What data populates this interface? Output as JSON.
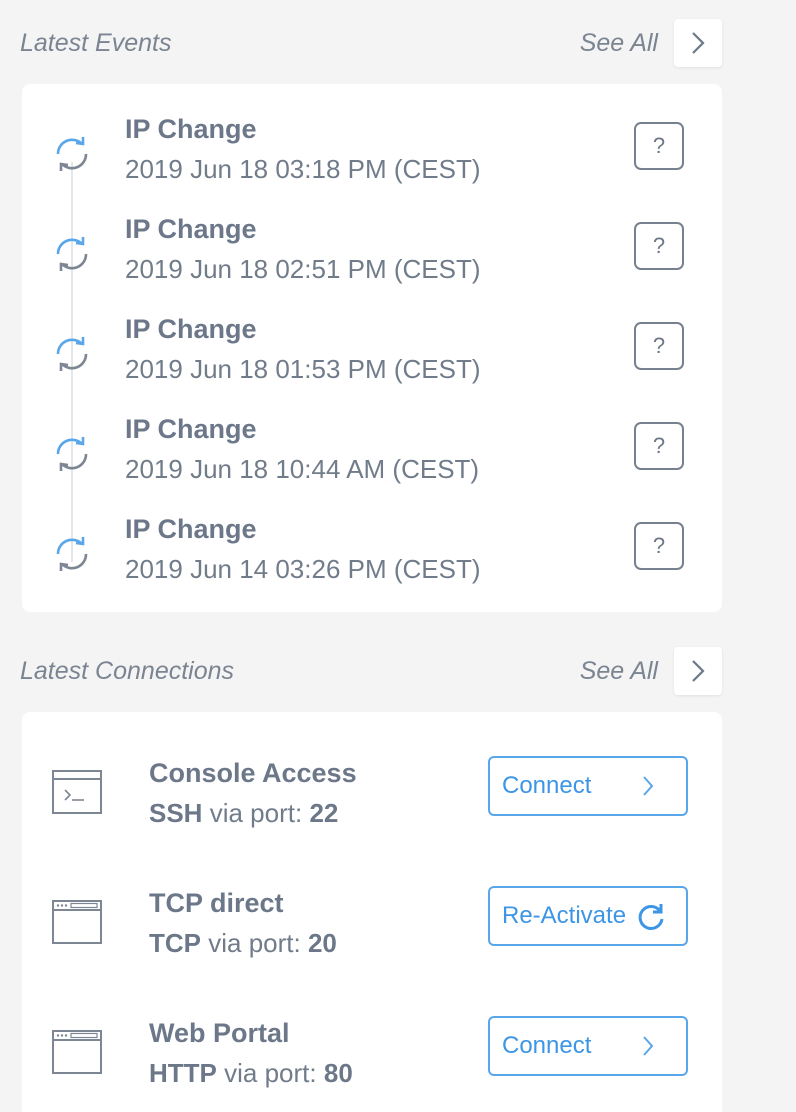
{
  "events_section": {
    "title": "Latest Events",
    "see_all": "See All",
    "items": [
      {
        "title": "IP Change",
        "date": "2019 Jun 18 03:18 PM (CEST)",
        "help": "?"
      },
      {
        "title": "IP Change",
        "date": "2019 Jun 18 02:51 PM (CEST)",
        "help": "?"
      },
      {
        "title": "IP Change",
        "date": "2019 Jun 18 01:53 PM (CEST)",
        "help": "?"
      },
      {
        "title": "IP Change",
        "date": "2019 Jun 18 10:44 AM (CEST)",
        "help": "?"
      },
      {
        "title": "IP Change",
        "date": "2019 Jun 14 03:26 PM (CEST)",
        "help": "?"
      }
    ]
  },
  "connections_section": {
    "title": "Latest Connections",
    "see_all": "See All",
    "items": [
      {
        "title": "Console Access",
        "protocol": "SSH",
        "via": "via port:",
        "port": "22",
        "icon": "terminal-window-icon",
        "action": "Connect",
        "action_icon": "chevron-right-icon"
      },
      {
        "title": "TCP direct",
        "protocol": "TCP",
        "via": "via port:",
        "port": "20",
        "icon": "browser-window-icon",
        "action": "Re-Activate",
        "action_icon": "refresh-icon"
      },
      {
        "title": "Web Portal",
        "protocol": "HTTP",
        "via": "via port:",
        "port": "80",
        "icon": "browser-window-icon",
        "action": "Connect",
        "action_icon": "chevron-right-icon"
      }
    ]
  },
  "colors": {
    "background": "#f4f4f4",
    "card": "#ffffff",
    "text": "#6c7889",
    "accent": "#3d95e5",
    "sync_icon_gray": "#7d8794",
    "sync_icon_blue": "#5aa6ea"
  }
}
